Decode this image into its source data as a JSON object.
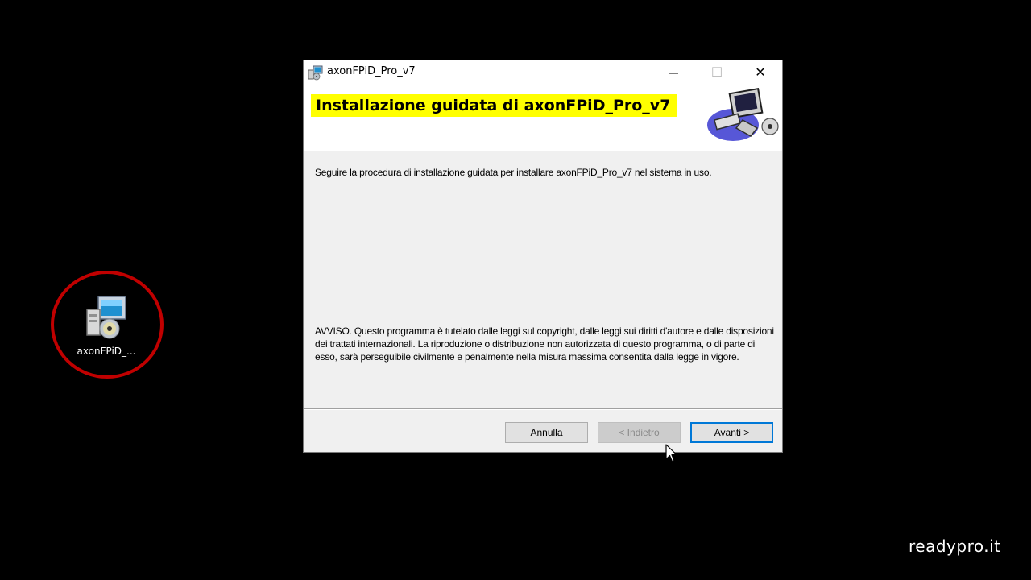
{
  "desktop": {
    "icon_label": "axonFPiD_...",
    "watermark": "readypro.it"
  },
  "window": {
    "title": "axonFPiD_Pro_v7",
    "controls": {
      "minimize": "—",
      "maximize": "☐",
      "close": "✕"
    },
    "banner_title": "Installazione guidata di axonFPiD_Pro_v7",
    "intro_text": "Seguire la procedura di installazione guidata per installare axonFPiD_Pro_v7 nel sistema in uso.",
    "notice_text": "AVVISO. Questo programma è tutelato dalle leggi sul copyright, dalle leggi sui diritti d'autore e dalle disposizioni dei trattati internazionali. La riproduzione o distribuzione non autorizzata di questo programma, o di parte di esso, sarà perseguibile civilmente e penalmente nella misura massima consentita dalla legge in vigore.",
    "buttons": {
      "cancel": "Annulla",
      "back": "< Indietro",
      "next": "Avanti >"
    }
  },
  "colors": {
    "highlight": "#ffff00",
    "circle": "#c00000",
    "focus": "#0078d7"
  }
}
